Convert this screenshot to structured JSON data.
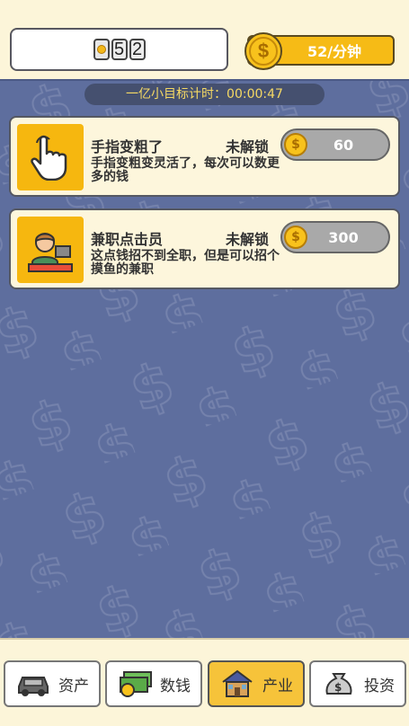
{
  "header": {
    "money_digits": [
      "5",
      "2"
    ],
    "rate_label": "52/分钟",
    "coin_glyph": "$"
  },
  "timer": {
    "text": "一亿小目标计时：00:00:47"
  },
  "industries": [
    {
      "title": "手指变粗了",
      "status": "未解锁",
      "desc": "手指变粗变灵活了，每次可以数更多的钱",
      "price": "60",
      "icon": "pointing-hand-icon"
    },
    {
      "title": "兼职点击员",
      "status": "未解锁",
      "desc": "这点钱招不到全职，但是可以招个摸鱼的兼职",
      "price": "300",
      "icon": "office-worker-icon"
    }
  ],
  "nav": [
    {
      "label": "资产",
      "icon": "car-icon",
      "active": false
    },
    {
      "label": "数钱",
      "icon": "cash-stack-icon",
      "active": false
    },
    {
      "label": "产业",
      "icon": "house-icon",
      "active": true
    },
    {
      "label": "投资",
      "icon": "money-bag-icon",
      "active": false
    }
  ],
  "colors": {
    "accent": "#f6bb16",
    "background": "#5e6e9e",
    "panel": "#fdf6dc"
  }
}
